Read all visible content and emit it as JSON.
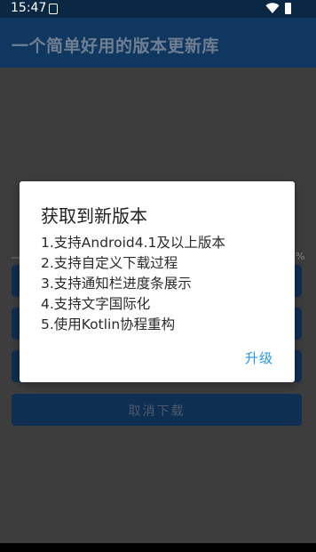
{
  "status_bar": {
    "time": "15:47"
  },
  "toolbar": {
    "title": "一个简单好用的版本更新库"
  },
  "progress": {
    "percent_label": "%"
  },
  "buttons": {
    "cancel_download": "取消下载"
  },
  "dialog": {
    "title": "获取到新版本",
    "lines": [
      "1.支持Android4.1及以上版本",
      "2.支持自定义下载过程",
      "3.支持通知栏进度条展示",
      "4.支持文字国际化",
      "5.使用Kotlin协程重构"
    ],
    "action_label": "升级"
  },
  "colors": {
    "accent": "#2196f3",
    "toolbar": "#10375f"
  }
}
